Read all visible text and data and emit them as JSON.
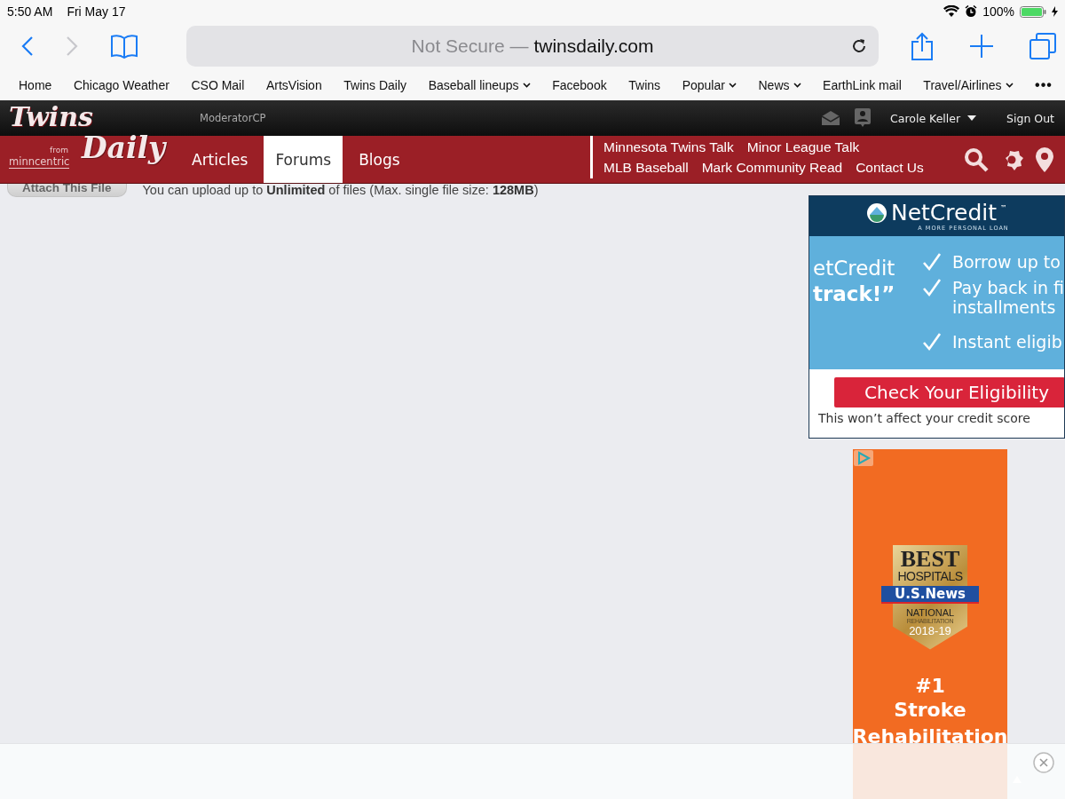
{
  "status_bar": {
    "time": "5:50 AM",
    "date": "Fri May 17",
    "battery_percent": "100%"
  },
  "toolbar": {
    "back": {
      "disabled": false
    },
    "forward": {
      "disabled": true
    },
    "url_prefix": "Not Secure —",
    "domain": "twinsdaily.com"
  },
  "bookmarks": [
    {
      "label": "Home",
      "dropdown": false
    },
    {
      "label": "Chicago Weather",
      "dropdown": false
    },
    {
      "label": "CSO Mail",
      "dropdown": false
    },
    {
      "label": "ArtsVision",
      "dropdown": false
    },
    {
      "label": "Twins Daily",
      "dropdown": false
    },
    {
      "label": "Baseball lineups",
      "dropdown": true
    },
    {
      "label": "Facebook",
      "dropdown": false
    },
    {
      "label": "Twins",
      "dropdown": false
    },
    {
      "label": "Popular",
      "dropdown": true
    },
    {
      "label": "News",
      "dropdown": true
    },
    {
      "label": "EarthLink mail",
      "dropdown": false
    },
    {
      "label": "Travel/Airlines",
      "dropdown": true
    }
  ],
  "bookmarks_more": "•••",
  "site_header": {
    "logo": {
      "wordmark_1": "Twins",
      "wordmark_2": "Daily",
      "from": "from",
      "brand": "minncentric"
    },
    "moderator_link": "ModeratorCP",
    "user": "Carole Keller",
    "sign_out": "Sign Out"
  },
  "nav_tabs": [
    {
      "label": "Articles",
      "selected": false
    },
    {
      "label": "Forums",
      "selected": true
    },
    {
      "label": "Blogs",
      "selected": false
    }
  ],
  "quick_link_rows": [
    {
      "links": [
        "Minnesota Twins Talk",
        "Minor League Talk"
      ]
    },
    {
      "links": [
        "MLB Baseball",
        "Mark Community Read",
        "Contact Us"
      ]
    }
  ],
  "content": {
    "attach_button": "Attach This File",
    "upload_note": "You can upload up to **Unlimited** of files (Max. single file size: **128MB**)"
  },
  "ad_loan": {
    "brand": "NetCredit",
    "trademark": "™",
    "tagline": "A MORE PERSONAL LOAN",
    "quote_1": "etCredit",
    "quote_2": "track!”",
    "features": [
      "Borrow up to",
      "Pay back in fi\ninstallments",
      "Instant eligib"
    ],
    "cta": "Check Your Eligibility",
    "note": "This won’t affect your credit score"
  },
  "ad_hospital": {
    "badge_1": "BEST",
    "badge_2": "HOSPITALS",
    "ribbon": "U.S.News",
    "badge_3": "NATIONAL",
    "badge_4": "REHABILITATION",
    "badge_5": "2018-19",
    "rank": "#1",
    "line_1": "Stroke",
    "line_2": "Rehabilitation"
  }
}
